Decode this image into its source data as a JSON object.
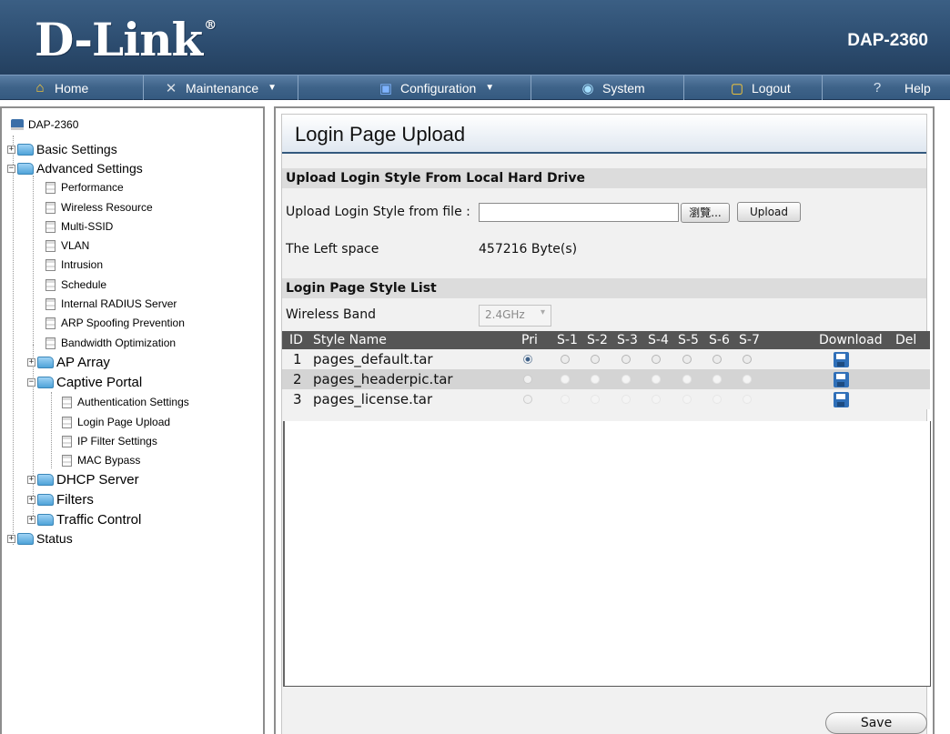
{
  "header": {
    "logo": "D-Link",
    "logo_reg": "®",
    "model": "DAP-2360"
  },
  "nav": {
    "home": "Home",
    "maintenance": "Maintenance",
    "configuration": "Configuration",
    "system": "System",
    "logout": "Logout",
    "help": "Help",
    "dropdown_caret": "▼"
  },
  "sidebar": {
    "root": "DAP-2360",
    "basic_settings": "Basic Settings",
    "advanced_settings": "Advanced Settings",
    "advanced_items": [
      "Performance",
      "Wireless Resource",
      "Multi-SSID",
      "VLAN",
      "Intrusion",
      "Schedule",
      "Internal RADIUS Server",
      "ARP Spoofing Prevention",
      "Bandwidth Optimization"
    ],
    "ap_array": "AP Array",
    "captive_portal": "Captive Portal",
    "captive_items": [
      "Authentication Settings",
      "Login Page Upload",
      "IP Filter Settings",
      "MAC Bypass"
    ],
    "dhcp_server": "DHCP Server",
    "filters": "Filters",
    "traffic_control": "Traffic Control",
    "status": "Status"
  },
  "main": {
    "title": "Login Page Upload",
    "upload_section": "Upload Login Style From Local Hard Drive",
    "upload_label": "Upload Login Style from file :",
    "file_value": "",
    "browse_label": "瀏覽...",
    "upload_button": "Upload",
    "left_space_label": "The Left space",
    "left_space_value": "457216 Byte(s)",
    "list_section": "Login Page Style List",
    "wireless_band_label": "Wireless Band",
    "wireless_band_value": "2.4GHz",
    "table": {
      "headers": {
        "id": "ID",
        "style_name": "Style Name",
        "pri": "Pri",
        "s1": "S-1",
        "s2": "S-2",
        "s3": "S-3",
        "s4": "S-4",
        "s5": "S-5",
        "s6": "S-6",
        "s7": "S-7",
        "download": "Download",
        "del": "Del"
      },
      "rows": [
        {
          "id": "1",
          "name": "pages_default.tar"
        },
        {
          "id": "2",
          "name": "pages_headerpic.tar"
        },
        {
          "id": "3",
          "name": "pages_license.tar"
        }
      ]
    },
    "save_button": "Save"
  }
}
